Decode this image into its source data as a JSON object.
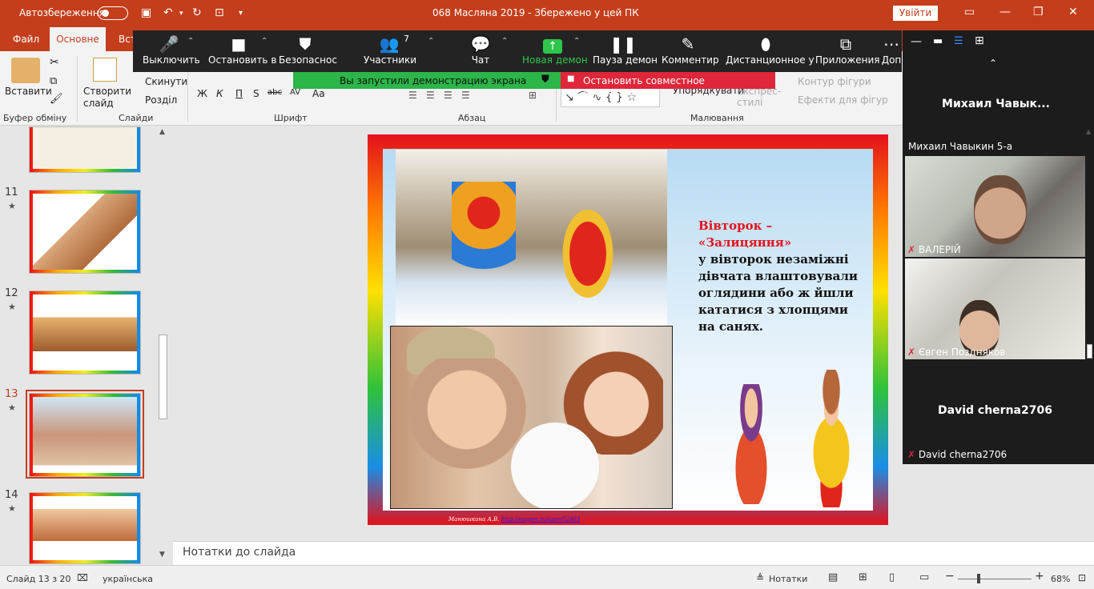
{
  "titlebar": {
    "autosave_label": "Автозбереження",
    "doc_title": "068 Масляна 2019  -  Збережено у цей ПК",
    "signin_label": "Увійти",
    "icons": [
      "save-icon",
      "undo-icon",
      "redo-icon",
      "presenter-icon",
      "customize-icon"
    ]
  },
  "tabs": {
    "file": "Файл",
    "home": "Основне",
    "insert": "Вст"
  },
  "ribbon": {
    "paste": "Вставити",
    "clipboard_group": "Буфер обміну",
    "new_slide": "Створити слайд",
    "reset": "Скинути",
    "section": "Розділ",
    "slides_group": "Слайди",
    "font_group": "Шрифт",
    "para_group": "Абзац",
    "arrange": "Упорядкувати",
    "express_styles": "Експрес-стилі",
    "shape_outline": "Контур фігури",
    "shape_effects": "Ефекти для фігур",
    "drawing_group": "Малювання",
    "font_buttons": [
      "Ж",
      "К",
      "П",
      "S",
      "abc",
      "AV",
      "Aa"
    ]
  },
  "zoom_toolbar": {
    "items": [
      {
        "label": "Выключить",
        "icon": "microphone-icon"
      },
      {
        "label": "Остановить в",
        "icon": "video-camera-icon"
      },
      {
        "label": "Безопаснос",
        "icon": "shield-icon"
      },
      {
        "label": "Участники",
        "icon": "participants-icon",
        "count": "7"
      },
      {
        "label": "Чат",
        "icon": "chat-icon"
      },
      {
        "label": "Новая демон",
        "icon": "share-screen-icon"
      },
      {
        "label": "Пауза демон",
        "icon": "pause-icon"
      },
      {
        "label": "Комментир",
        "icon": "pencil-icon"
      },
      {
        "label": "Дистанционное у",
        "icon": "mouse-icon"
      },
      {
        "label": "Приложения",
        "icon": "apps-icon"
      },
      {
        "label": "Доп",
        "icon": "more-icon"
      }
    ],
    "sharing_notice": "Вы запустили демонстрацию экрана",
    "stop_share": "Остановить совместное использование"
  },
  "thumbnails": [
    {
      "num": "11",
      "star": "★"
    },
    {
      "num": "12",
      "star": "★"
    },
    {
      "num": "13",
      "star": "★"
    },
    {
      "num": "14",
      "star": "★"
    }
  ],
  "slide": {
    "heading": "Вівторок –  «Залицяння»",
    "body": "у вівторок незаміжні дівчата влаштовували оглядини або ж йшли кататися з хлопцями на санях.",
    "credit": "Манюшкина А.В.",
    "credit_link": "http://easyen.ru/user/52463"
  },
  "notes": {
    "placeholder": "Нотатки до слайда"
  },
  "status": {
    "slide_info": "Слайд 13 з 20",
    "language": "українська",
    "notes_button": "Нотатки",
    "zoom_percent": "68%"
  },
  "participants": {
    "top_name": "Михаил  Чавык...",
    "top_subname": "Михаил Чавыкин 5-а",
    "tiles": [
      {
        "name": "ВАЛЕРІЙ"
      },
      {
        "name": "Євген Поздняков"
      },
      {
        "name": "David cherna2706",
        "big": "David cherna2706"
      }
    ]
  },
  "colors": {
    "office_accent": "#c43e1c",
    "zoom_green": "#2cb549",
    "zoom_red": "#e0263a",
    "zoom_dark": "#232323"
  }
}
